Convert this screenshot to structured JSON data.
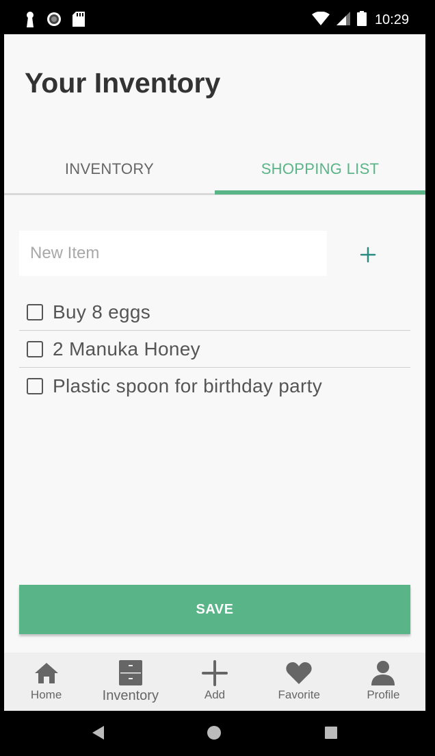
{
  "status_bar": {
    "time": "10:29"
  },
  "app": {
    "title": "Your Inventory"
  },
  "tabs": [
    {
      "label": "INVENTORY",
      "active": false
    },
    {
      "label": "SHOPPING LIST",
      "active": true
    }
  ],
  "new_item": {
    "placeholder": "New Item",
    "value": ""
  },
  "shopping_list": [
    {
      "label": "Buy 8 eggs",
      "checked": false
    },
    {
      "label": "2 Manuka Honey",
      "checked": false
    },
    {
      "label": "Plastic spoon for birthday party",
      "checked": false
    }
  ],
  "save_button": {
    "label": "SAVE"
  },
  "bottom_nav": [
    {
      "label": "Home",
      "icon": "home-icon"
    },
    {
      "label": "Inventory",
      "icon": "cabinet-icon",
      "current": true
    },
    {
      "label": "Add",
      "icon": "plus-icon"
    },
    {
      "label": "Favorite",
      "icon": "heart-icon"
    },
    {
      "label": "Profile",
      "icon": "person-icon"
    }
  ],
  "colors": {
    "accent": "#59b487",
    "add_icon": "#2a8a7f",
    "nav_icon": "#666666"
  }
}
